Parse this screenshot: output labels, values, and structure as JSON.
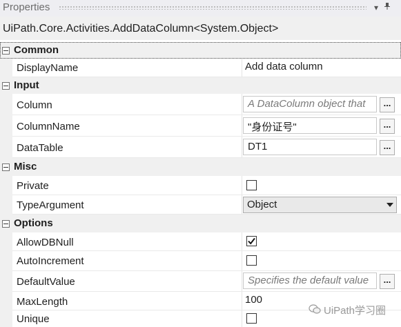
{
  "panel": {
    "title": "Properties",
    "pin_icon": "pin-icon",
    "close_icon": "close-icon",
    "dropdown_icon": "chevron-down-icon"
  },
  "class_name": "UiPath.Core.Activities.AddDataColumn<System.Object>",
  "categories": {
    "common": "Common",
    "input": "Input",
    "misc": "Misc",
    "options": "Options"
  },
  "properties": {
    "display_name": {
      "name": "DisplayName",
      "value": "Add data column"
    },
    "column": {
      "name": "Column",
      "placeholder": "A DataColumn object that"
    },
    "column_name": {
      "name": "ColumnName",
      "value": "\"身份证号\""
    },
    "data_table": {
      "name": "DataTable",
      "value": "DT1"
    },
    "private": {
      "name": "Private",
      "checked": false
    },
    "type_argument": {
      "name": "TypeArgument",
      "value": "Object"
    },
    "allow_db_null": {
      "name": "AllowDBNull",
      "checked": true
    },
    "auto_increment": {
      "name": "AutoIncrement",
      "checked": false
    },
    "default_value": {
      "name": "DefaultValue",
      "placeholder": "Specifies the default value"
    },
    "max_length": {
      "name": "MaxLength",
      "value": "100"
    },
    "unique": {
      "name": "Unique",
      "checked": false
    }
  },
  "ellipsis_label": "...",
  "watermark": {
    "text": "UiPath学习圈",
    "icon": "wechat-icon"
  }
}
